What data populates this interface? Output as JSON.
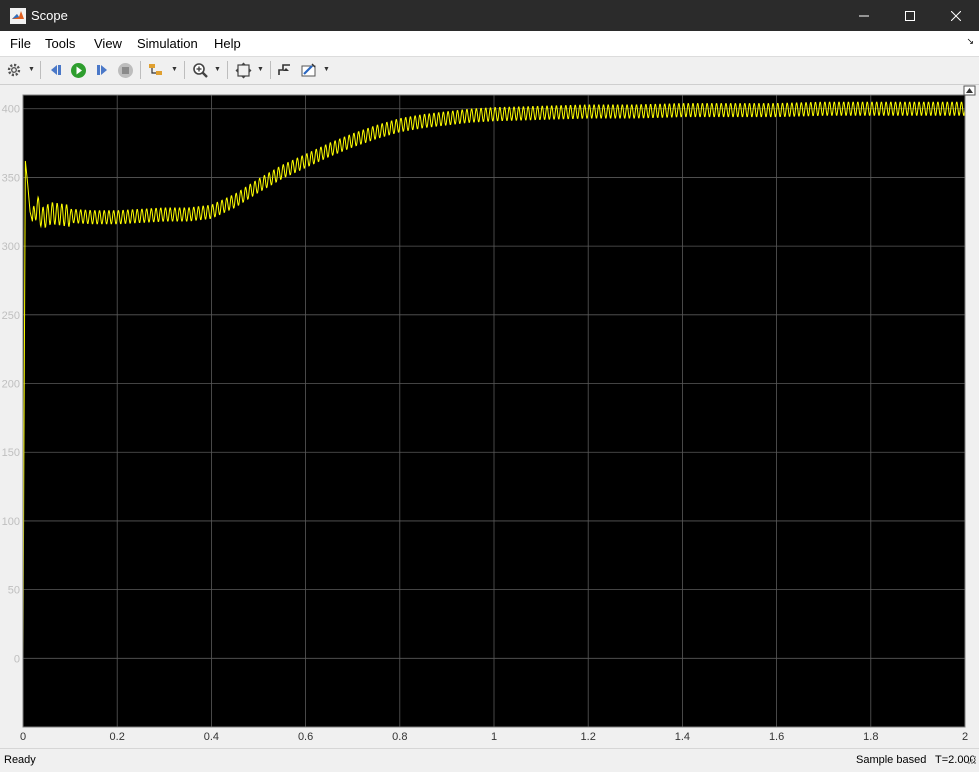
{
  "window": {
    "title": "Scope"
  },
  "menu": [
    "File",
    "Tools",
    "View",
    "Simulation",
    "Help"
  ],
  "toolbar": [
    {
      "name": "configuration-properties-icon",
      "dropdown": true
    },
    {
      "name": "step-back-icon",
      "dropdown": false
    },
    {
      "name": "run-icon",
      "dropdown": false
    },
    {
      "name": "step-forward-icon",
      "dropdown": false
    },
    {
      "name": "stop-icon",
      "dropdown": false
    },
    {
      "name": "highlight-simulink-block-icon",
      "dropdown": true
    },
    {
      "name": "zoom-in-icon",
      "dropdown": true
    },
    {
      "name": "fit-to-view-icon",
      "dropdown": true
    },
    {
      "name": "triggers-icon",
      "dropdown": false
    },
    {
      "name": "cursor-measurements-icon",
      "dropdown": true
    }
  ],
  "status": {
    "left": "Ready",
    "mode": "Sample based",
    "time": "T=2.000"
  },
  "colors": {
    "plot_bg": "#000000",
    "trace": "#ffff00",
    "grid": "#5a5a5a",
    "tick_text": "#bfbfbf"
  },
  "chart_data": {
    "type": "line",
    "title": "",
    "xlabel": "",
    "ylabel": "",
    "xlim": [
      0,
      2
    ],
    "ylim": [
      -50,
      410
    ],
    "xticks": [
      0,
      0.2,
      0.4,
      0.6,
      0.8,
      1,
      1.2,
      1.4,
      1.6,
      1.8,
      2
    ],
    "xtick_labels": [
      "0",
      "0.2",
      "0.4",
      "0.6",
      "0.8",
      "1",
      "1.2",
      "1.4",
      "1.6",
      "1.8",
      "2"
    ],
    "yticks": [
      0,
      50,
      100,
      150,
      200,
      250,
      300,
      350,
      400
    ],
    "ytick_labels": [
      "0",
      "50",
      "100",
      "150",
      "200",
      "250",
      "300",
      "350",
      "400"
    ],
    "grid": true,
    "series": [
      {
        "ripple_amplitude": 5,
        "ripple_period": 0.01,
        "x": [
          0,
          0.002,
          0.005,
          0.01,
          0.015,
          0.02,
          0.03,
          0.04,
          0.06,
          0.1,
          0.15,
          0.2,
          0.25,
          0.3,
          0.35,
          0.4,
          0.45,
          0.5,
          0.55,
          0.6,
          0.65,
          0.7,
          0.75,
          0.8,
          0.85,
          0.9,
          0.95,
          1.0,
          1.1,
          1.2,
          1.3,
          1.4,
          1.5,
          1.6,
          1.7,
          1.8,
          1.9,
          2.0
        ],
        "y": [
          0,
          160,
          362,
          345,
          325,
          318,
          330,
          320,
          324,
          322,
          321,
          321,
          322,
          323,
          323,
          325,
          333,
          344,
          354,
          362,
          370,
          377,
          383,
          388,
          391,
          393,
          395,
          396,
          397,
          398,
          398,
          399,
          399,
          399,
          400,
          400,
          400,
          400
        ]
      }
    ]
  }
}
